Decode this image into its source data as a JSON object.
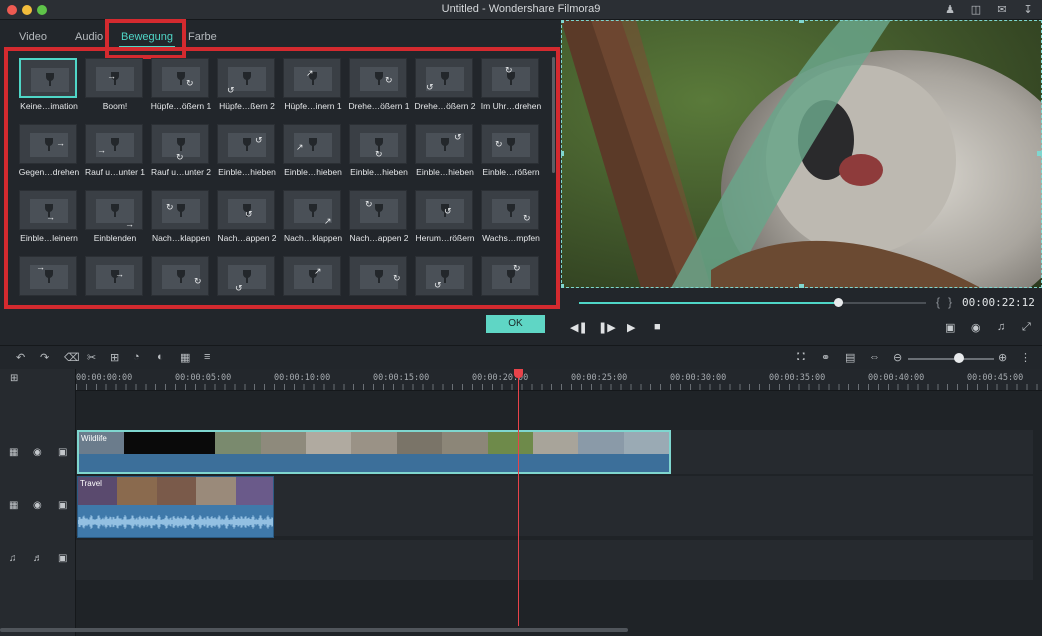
{
  "window": {
    "title": "Untitled - Wondershare Filmora9"
  },
  "tabs": [
    {
      "label": "Video"
    },
    {
      "label": "Audio"
    },
    {
      "label": "Bewegung",
      "active": true
    },
    {
      "label": "Farbe"
    }
  ],
  "presets": [
    "Keine…imation",
    "Boom!",
    "Hüpfe…ößern 1",
    "Hüpfe…ßern 2",
    "Hüpfe…inern 1",
    "Drehe…ößern 1",
    "Drehe…ößern 2",
    "Im Uhr…drehen",
    "Gegen…drehen",
    "Rauf u…unter 1",
    "Rauf u…unter 2",
    "Einble…hieben",
    "Einble…hieben",
    "Einble…hieben",
    "Einble…hieben",
    "Einble…rößern",
    "Einble…leinern",
    "Einblenden",
    "Nach…klappen",
    "Nach…appen 2",
    "Nach…klappen",
    "Nach…appen 2",
    "Herum…rößern",
    "Wachs…mpfen",
    "",
    "",
    "",
    "",
    "",
    "",
    "",
    ""
  ],
  "ok_label": "OK",
  "player": {
    "timecode": "00:00:22:12",
    "progress": 0.745
  },
  "ruler": {
    "labels": [
      "00:00:00:00",
      "00:00:05:00",
      "00:00:10:00",
      "00:00:15:00",
      "00:00:20:00",
      "00:00:25:00",
      "00:00:30:00",
      "00:00:35:00",
      "00:00:40:00",
      "00:00:45:00"
    ]
  },
  "clips": {
    "video_label": "Wildlife",
    "audio_label": "Travel"
  },
  "colors": {
    "accent": "#4fd6c7",
    "highlight_red": "#d42a2f",
    "playhead": "#e8434a"
  }
}
